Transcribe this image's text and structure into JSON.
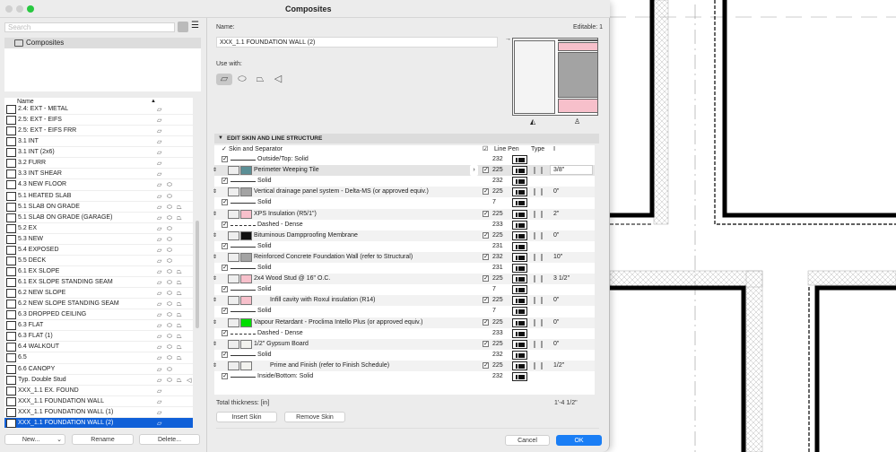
{
  "window": {
    "title": "Composites"
  },
  "left_panel": {
    "search_placeholder": "Search",
    "tree_folder": "Composites",
    "list_header": "Name",
    "items": [
      {
        "name": "2.4: EXT - METAL",
        "uses": [
          "wall"
        ]
      },
      {
        "name": "2.5: EXT - EIFS",
        "uses": [
          "wall"
        ]
      },
      {
        "name": "2.5: EXT - EIFS FRR",
        "uses": [
          "wall"
        ]
      },
      {
        "name": "3.1 INT",
        "uses": [
          "wall"
        ]
      },
      {
        "name": "3.1 INT (2x6)",
        "uses": [
          "wall"
        ]
      },
      {
        "name": "3.2 FURR",
        "uses": [
          "wall"
        ]
      },
      {
        "name": "3.3 INT SHEAR",
        "uses": [
          "wall"
        ]
      },
      {
        "name": "4.3 NEW FLOOR",
        "uses": [
          "wall",
          "slab"
        ]
      },
      {
        "name": "5.1 HEATED SLAB",
        "uses": [
          "wall",
          "slab"
        ]
      },
      {
        "name": "5.1 SLAB ON GRADE",
        "uses": [
          "wall",
          "slab",
          "roof"
        ]
      },
      {
        "name": "5.1 SLAB ON GRADE (GARAGE)",
        "uses": [
          "wall",
          "slab",
          "roof"
        ]
      },
      {
        "name": "5.2 EX",
        "uses": [
          "wall",
          "slab"
        ]
      },
      {
        "name": "5.3 NEW",
        "uses": [
          "wall",
          "slab"
        ]
      },
      {
        "name": "5.4 EXPOSED",
        "uses": [
          "wall",
          "slab"
        ]
      },
      {
        "name": "5.5 DECK",
        "uses": [
          "wall",
          "slab"
        ]
      },
      {
        "name": "6.1 EX SLOPE",
        "uses": [
          "wall",
          "slab",
          "roof"
        ]
      },
      {
        "name": "6.1 EX SLOPE STANDING SEAM",
        "uses": [
          "wall",
          "slab",
          "roof"
        ]
      },
      {
        "name": "6.2 NEW SLOPE",
        "uses": [
          "wall",
          "slab",
          "roof"
        ]
      },
      {
        "name": "6.2 NEW SLOPE STANDING SEAM",
        "uses": [
          "wall",
          "slab",
          "roof"
        ]
      },
      {
        "name": "6.3 DROPPED CEILING",
        "uses": [
          "wall",
          "slab",
          "roof"
        ]
      },
      {
        "name": "6.3 FLAT",
        "uses": [
          "wall",
          "slab",
          "roof"
        ]
      },
      {
        "name": "6.3 FLAT (1)",
        "uses": [
          "wall",
          "slab",
          "roof"
        ]
      },
      {
        "name": "6.4 WALKOUT",
        "uses": [
          "wall",
          "slab",
          "roof"
        ]
      },
      {
        "name": "6.5",
        "uses": [
          "wall",
          "slab",
          "roof"
        ]
      },
      {
        "name": "6.6 CANOPY",
        "uses": [
          "wall",
          "slab"
        ]
      },
      {
        "name": "Typ. Double Stud",
        "uses": [
          "wall",
          "slab",
          "roof",
          "shell"
        ]
      },
      {
        "name": "XXX_1.1 EX. FOUND",
        "uses": [
          "wall"
        ]
      },
      {
        "name": "XXX_1.1 FOUNDATION WALL",
        "uses": [
          "wall"
        ]
      },
      {
        "name": "XXX_1.1 FOUNDATION WALL (1)",
        "uses": [
          "wall"
        ]
      },
      {
        "name": "XXX_1.1 FOUNDATION WALL (2)",
        "uses": [
          "wall"
        ],
        "selected": true
      }
    ],
    "buttons": {
      "new": "New...",
      "rename": "Rename",
      "delete": "Delete..."
    }
  },
  "main": {
    "name_label": "Name:",
    "name_value": "XXX_1.1 FOUNDATION WALL (2)",
    "editable": "Editable: 1",
    "use_with_label": "Use with:",
    "use_with": [
      {
        "icon": "wall-icon",
        "active": true
      },
      {
        "icon": "slab-icon"
      },
      {
        "icon": "roof-icon"
      },
      {
        "icon": "shell-icon"
      }
    ],
    "section_title": "EDIT SKIN AND LINE STRUCTURE",
    "columns": {
      "skin": "Skin and Separator",
      "line_pen": "Line Pen",
      "type": "Type"
    },
    "rows": [
      {
        "kind": "sep",
        "line": "solid",
        "label": "Outside/Top: Solid",
        "pen": "232"
      },
      {
        "kind": "skin",
        "fill": "#5b8f96",
        "label": "Perimeter Weeping Tile",
        "pen": "225",
        "thickness": "3/8\"",
        "highlighted": true
      },
      {
        "kind": "sep",
        "line": "solid",
        "label": "Solid",
        "pen": "232"
      },
      {
        "kind": "skin",
        "fill": "#a3a3a3",
        "label": "Vertical drainage panel system - Delta-MS (or approved equiv.)",
        "pen": "225",
        "thickness": "0\""
      },
      {
        "kind": "sep",
        "line": "solid",
        "label": "Solid",
        "pen": "7"
      },
      {
        "kind": "skin",
        "fill": "#f7c0cb",
        "label": "XPS Insulation (R5/1\")",
        "pen": "225",
        "thickness": "2\""
      },
      {
        "kind": "sep",
        "line": "dashed",
        "label": "Dashed - Dense",
        "pen": "233"
      },
      {
        "kind": "skin",
        "fill": "#111111",
        "label": "Bituminous Dampproofing Membrane",
        "pen": "225",
        "thickness": "0\""
      },
      {
        "kind": "sep",
        "line": "solid",
        "label": "Solid",
        "pen": "231"
      },
      {
        "kind": "skin",
        "fill": "#a3a3a3",
        "label": "Reinforced Concrete Foundation Wall (refer to Structural)",
        "pen": "232",
        "thickness": "10\""
      },
      {
        "kind": "sep",
        "line": "solid",
        "label": "Solid",
        "pen": "231"
      },
      {
        "kind": "skin",
        "fill": "#f7c0cb",
        "label": "2x4 Wood Stud @ 16\" O.C.",
        "pen": "225",
        "thickness": "3 1/2\""
      },
      {
        "kind": "sep",
        "line": "solid",
        "label": "Solid",
        "pen": "7"
      },
      {
        "kind": "skin",
        "fill": "#f7c0cb",
        "label": "Infill cavity with Roxul insulation (R14)",
        "pen": "225",
        "thickness": "0\"",
        "indent": true
      },
      {
        "kind": "sep",
        "line": "solid",
        "label": "Solid",
        "pen": "7"
      },
      {
        "kind": "skin",
        "fill": "#00dd00",
        "label": "Vapour Retardant - Proclima Intello Plus (or approved equiv.)",
        "pen": "225",
        "thickness": "0\""
      },
      {
        "kind": "sep",
        "line": "dashed",
        "label": "Dashed - Dense",
        "pen": "233"
      },
      {
        "kind": "skin",
        "fill": "#f2f2ee",
        "label": "1/2\" Gypsum Board",
        "pen": "225",
        "thickness": "0\""
      },
      {
        "kind": "sep",
        "line": "solid",
        "label": "Solid",
        "pen": "232"
      },
      {
        "kind": "skin",
        "fill": "#f2f2ee",
        "label": "Prime and Finish (refer to Finish Schedule)",
        "pen": "225",
        "thickness": "1/2\"",
        "indent": true
      },
      {
        "kind": "sep",
        "line": "solid",
        "label": "Inside/Bottom: Solid",
        "pen": "232"
      }
    ],
    "total_label": "Total thickness: [in]",
    "total_value": "1'-4 1/2\"",
    "buttons": {
      "insert": "Insert Skin",
      "remove": "Remove Skin",
      "cancel": "Cancel",
      "ok": "OK"
    },
    "colors": {
      "accent": "#1a7ef5",
      "selection": "#1060d8",
      "close_dot": "#d0d0d0",
      "zoom_dot": "#28c840"
    }
  }
}
